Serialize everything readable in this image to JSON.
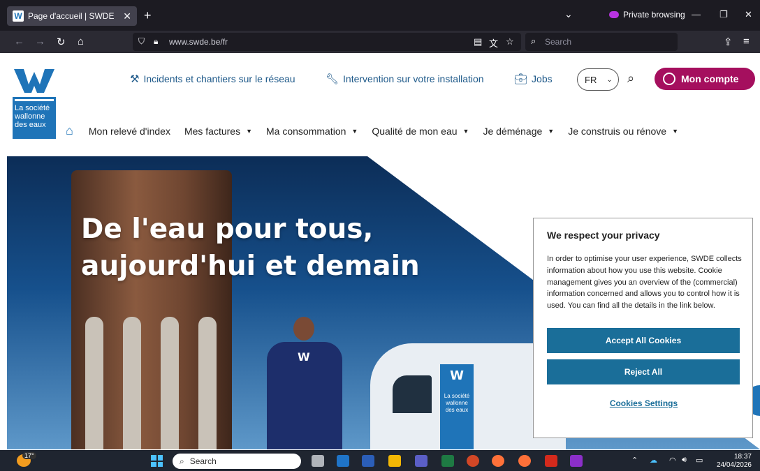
{
  "browser": {
    "tab_title": "Page d'accueil | SWDE",
    "tab_close": "✕",
    "new_tab": "+",
    "tabs_list": "⌄",
    "private_label": "Private browsing",
    "url": "www.swde.be/fr",
    "search_placeholder": "Search",
    "win_min": "—",
    "win_restore": "❐",
    "win_close": "✕"
  },
  "logo": {
    "letter": "W",
    "line1": "La société",
    "line2": "wallonne",
    "line3": "des eaux",
    "colors": {
      "primary": "#1f74b8"
    }
  },
  "header": {
    "links": [
      {
        "label": "Incidents et chantiers sur le réseau",
        "icon": "worker-icon"
      },
      {
        "label": "Intervention sur votre installation",
        "icon": "wrench-icon"
      },
      {
        "label": "Jobs",
        "icon": "briefcase-icon"
      }
    ],
    "language": "FR",
    "account_label": "Mon compte",
    "accent_color": "#a50f5e"
  },
  "main_nav": [
    {
      "label": "Mon relevé d'index",
      "dropdown": false
    },
    {
      "label": "Mes factures",
      "dropdown": true
    },
    {
      "label": "Ma consommation",
      "dropdown": true
    },
    {
      "label": "Qualité de mon eau",
      "dropdown": true
    },
    {
      "label": "Je déménage",
      "dropdown": true
    },
    {
      "label": "Je construis ou rénove",
      "dropdown": true
    }
  ],
  "hero": {
    "title_line1": "De l'eau pour tous,",
    "title_line2": "aujourd'hui et demain",
    "shirt_logo": "W",
    "van_logo": "W",
    "van_text": "La société wallonne des eaux"
  },
  "cookie": {
    "title": "We respect your privacy",
    "body": "In order to optimise your user experience, SWDE collects information about how you use this website. Cookie management gives you an overview of the (commercial) information concerned and allows you to control how it is used. You can find all the details in the link below.",
    "accept_label": "Accept All Cookies",
    "reject_label": "Reject All",
    "settings_label": "Cookies Settings",
    "button_color": "#1a6e99"
  },
  "taskbar": {
    "weather_temp": "17°",
    "search_placeholder": "Search",
    "time": "18:37",
    "date": "24/04/2026"
  }
}
